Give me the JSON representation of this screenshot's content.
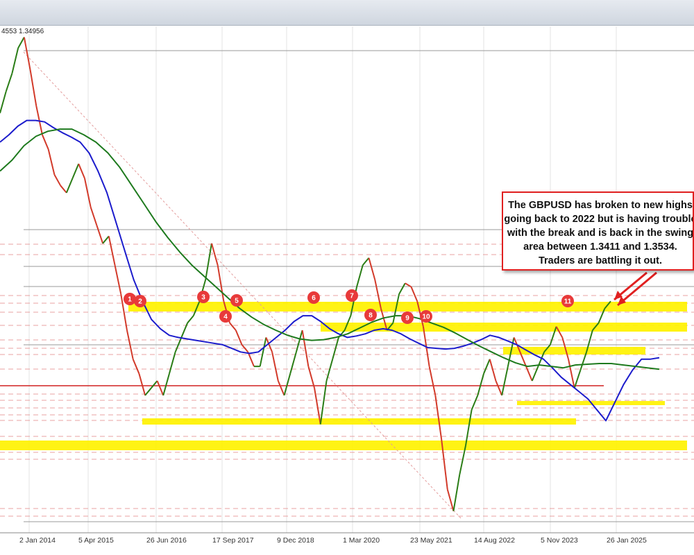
{
  "header": {
    "info_text": "4553 1.34956"
  },
  "chart_data": {
    "type": "line",
    "title": "",
    "xlabel": "",
    "ylabel": "",
    "x_ticks": [
      "2 Jan 2014",
      "5 Apr 2015",
      "26 Jun 2016",
      "17 Sep 2017",
      "9 Dec 2018",
      "1 Mar 2020",
      "23 May 2021",
      "14 Aug 2022",
      "5 Nov 2023",
      "26 Jan 2025"
    ],
    "grid": true,
    "series": [
      {
        "values": [
          1.61,
          1.64,
          1.665,
          1.7,
          1.715,
          1.67,
          1.62,
          1.58,
          1.56,
          1.525,
          1.51,
          1.5,
          1.52,
          1.54,
          1.52,
          1.48,
          1.455,
          1.43,
          1.44,
          1.4,
          1.36,
          1.31,
          1.27,
          1.25,
          1.22,
          1.23,
          1.24,
          1.22,
          1.25,
          1.28,
          1.3,
          1.32,
          1.33,
          1.35,
          1.38,
          1.43,
          1.4,
          1.35,
          1.32,
          1.31,
          1.29,
          1.28,
          1.26,
          1.26,
          1.3,
          1.28,
          1.24,
          1.22,
          1.25,
          1.28,
          1.31,
          1.26,
          1.23,
          1.18,
          1.24,
          1.27,
          1.3,
          1.31,
          1.33,
          1.37,
          1.4,
          1.41,
          1.38,
          1.34,
          1.31,
          1.32,
          1.36,
          1.375,
          1.37,
          1.35,
          1.315,
          1.26,
          1.22,
          1.16,
          1.09,
          1.06,
          1.11,
          1.15,
          1.2,
          1.22,
          1.25,
          1.27,
          1.24,
          1.22,
          1.26,
          1.3,
          1.28,
          1.26,
          1.24,
          1.26,
          1.28,
          1.29,
          1.315,
          1.3,
          1.27,
          1.23,
          1.255,
          1.28,
          1.31,
          1.32,
          1.34,
          1.35
        ]
      },
      {
        "values": [
          1.57,
          1.58,
          1.592,
          1.6,
          1.6,
          1.598,
          1.59,
          1.583,
          1.577,
          1.57,
          1.555,
          1.53,
          1.5,
          1.46,
          1.42,
          1.38,
          1.35,
          1.325,
          1.312,
          1.303,
          1.3,
          1.298,
          1.296,
          1.294,
          1.292,
          1.29,
          1.285,
          1.28,
          1.278,
          1.28,
          1.29,
          1.3,
          1.31,
          1.322,
          1.33,
          1.33,
          1.322,
          1.312,
          1.305,
          1.3,
          1.302,
          1.305,
          1.31,
          1.312,
          1.31,
          1.305,
          1.298,
          1.292,
          1.286,
          1.285,
          1.284,
          1.285,
          1.288,
          1.292,
          1.297,
          1.303,
          1.3,
          1.295,
          1.29,
          1.283,
          1.276,
          1.27,
          1.258,
          1.245,
          1.235,
          1.225,
          1.215,
          1.2,
          1.185,
          1.21,
          1.235,
          1.255,
          1.27,
          1.27,
          1.272
        ]
      },
      {
        "values": [
          1.53,
          1.545,
          1.565,
          1.578,
          1.585,
          1.588,
          1.588,
          1.58,
          1.57,
          1.555,
          1.535,
          1.51,
          1.485,
          1.46,
          1.438,
          1.418,
          1.4,
          1.385,
          1.37,
          1.355,
          1.34,
          1.328,
          1.318,
          1.31,
          1.303,
          1.298,
          1.296,
          1.297,
          1.3,
          1.305,
          1.313,
          1.321,
          1.327,
          1.33,
          1.33,
          1.326,
          1.32,
          1.314,
          1.306,
          1.297,
          1.288,
          1.28,
          1.272,
          1.265,
          1.26,
          1.262,
          1.26,
          1.258,
          1.262,
          1.263,
          1.264,
          1.264,
          1.262,
          1.26,
          1.258,
          1.256
        ]
      }
    ],
    "series_colors": [
      "#2a7d16",
      "#1c1ccc",
      "#1e7a1e"
    ],
    "support_resistance_zones": [
      {
        "label_markers": [
          "1",
          "2",
          "3",
          "5",
          "6",
          "7",
          "11"
        ]
      }
    ],
    "zone_fill_color": "#fff200",
    "level_line_color": "#e04040",
    "numbered_markers": [
      "1",
      "2",
      "3",
      "4",
      "5",
      "6",
      "7",
      "8",
      "9",
      "10",
      "11"
    ],
    "marker_color": "#e83a3a",
    "annotation": {
      "lines": [
        "The GBPUSD has broken to new highs",
        "going back to 2022 but is having trouble",
        "with the break and is back in the swing",
        "area between 1.3411 and 1.3534.",
        "Traders are battling it out."
      ],
      "border_color": "#e02020"
    }
  }
}
